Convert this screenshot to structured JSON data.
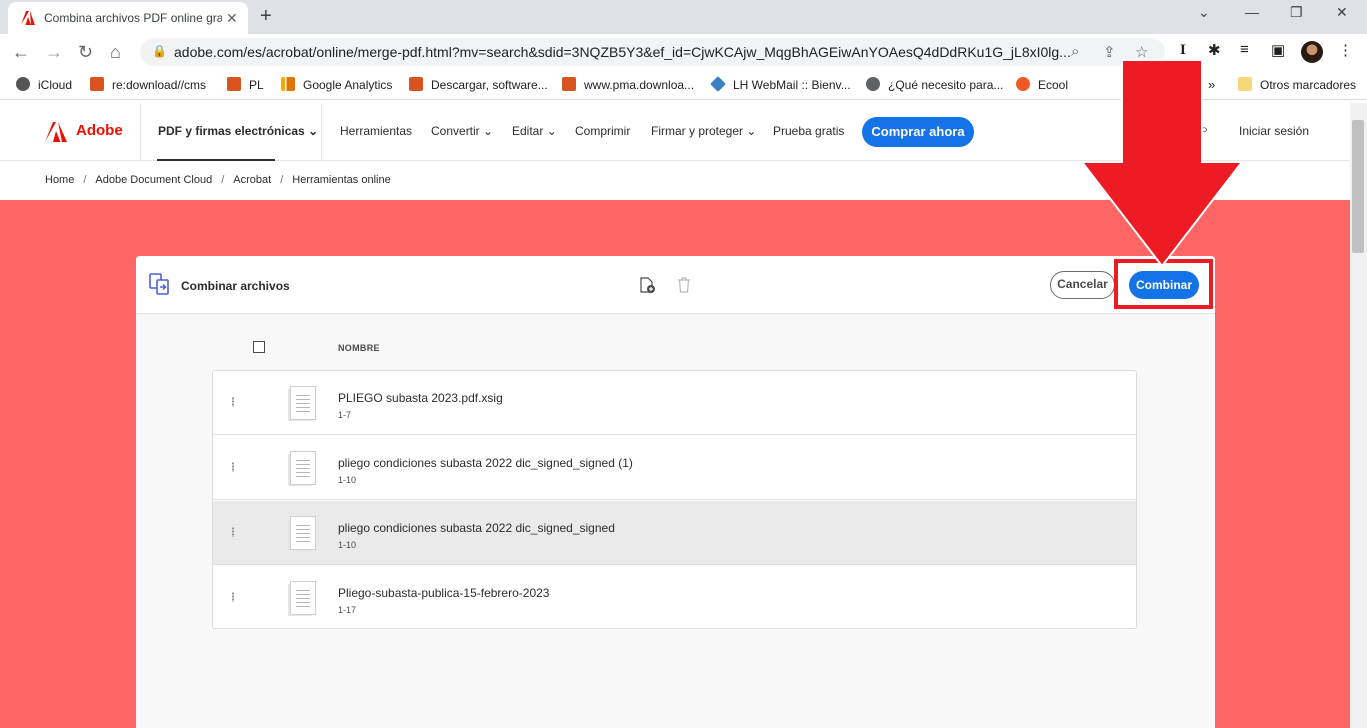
{
  "browser": {
    "tab_title": "Combina archivos PDF online gra",
    "url": "adobe.com/es/acrobat/online/merge-pdf.html?mv=search&sdid=3NQZB5Y3&ef_id=CjwKCAjw_MqgBhAGEiwAnYOAesQ4dDdRKu1G_jL8xI0lg...",
    "bookmarks": [
      {
        "label": "iCloud",
        "color": "#555555"
      },
      {
        "label": "re:download//cms",
        "color": "#d9531e"
      },
      {
        "label": "PL",
        "color": "#d9531e"
      },
      {
        "label": "Google Analytics",
        "color": "#f9ab00"
      },
      {
        "label": "Descargar, software...",
        "color": "#d9531e"
      },
      {
        "label": "www.pma.downloa...",
        "color": "#d9531e"
      },
      {
        "label": "LH WebMail :: Bienv...",
        "color": "#3b82c4"
      },
      {
        "label": "¿Qué necesito para...",
        "color": "#5f6368"
      },
      {
        "label": "Ecool",
        "color": "#f05a22"
      }
    ],
    "bookmarks_overflow": "»",
    "other_bookmarks": "Otros marcadores"
  },
  "adobe_nav": {
    "brand": "Adobe",
    "product": "PDF y firmas electrónicas",
    "items": [
      "Herramientas",
      "Convertir",
      "Editar",
      "Comprimir",
      "Firmar y proteger",
      "Prueba gratis"
    ],
    "buy_now": "Comprar ahora",
    "sign_in": "Iniciar sesión"
  },
  "breadcrumb": [
    "Home",
    "Adobe Document Cloud",
    "Acrobat",
    "Herramientas online"
  ],
  "panel": {
    "title": "Combinar archivos",
    "cancel_label": "Cancelar",
    "combine_label": "Combinar",
    "column_header": "NOMBRE",
    "files": [
      {
        "name": "PLIEGO subasta 2023.pdf.xsig",
        "pages": "1-7"
      },
      {
        "name": "pliego condiciones subasta 2022 dic_signed_signed (1)",
        "pages": "1-10"
      },
      {
        "name": "pliego condiciones subasta 2022 dic_signed_signed",
        "pages": "1-10"
      },
      {
        "name": "Pliego-subasta-publica-15-febrero-2023",
        "pages": "1-17"
      }
    ]
  },
  "colors": {
    "hero_bg": "#fe6666",
    "adobe_red": "#eb1000",
    "accent_blue": "#1473e6",
    "annotation_red": "#ed1c24"
  }
}
